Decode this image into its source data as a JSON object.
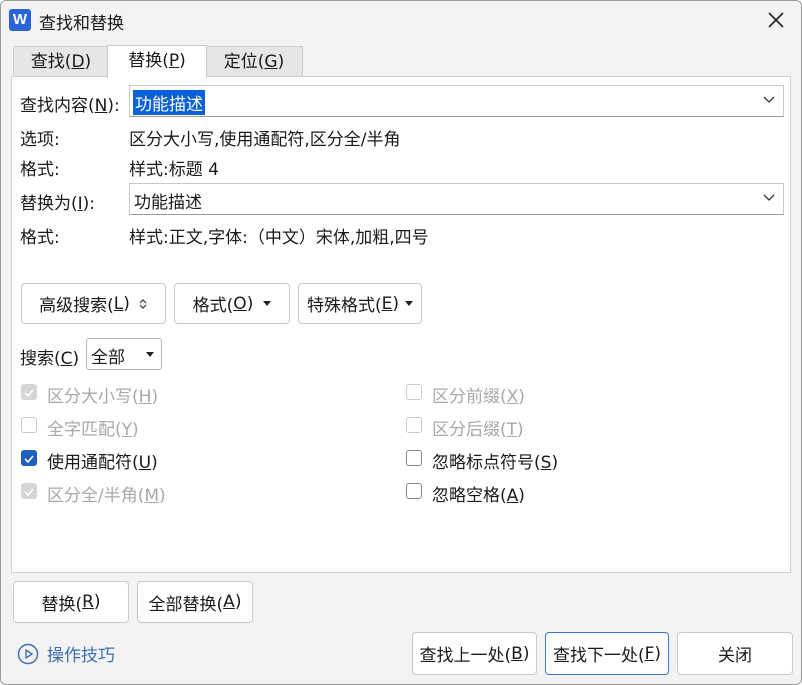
{
  "window": {
    "title": "查找和替换",
    "app_icon_letter": "W"
  },
  "tabs": [
    {
      "label": "查找(",
      "key": "D",
      "suffix": ")"
    },
    {
      "label": "替换(",
      "key": "P",
      "suffix": ")"
    },
    {
      "label": "定位(",
      "key": "G",
      "suffix": ")"
    }
  ],
  "find": {
    "label": "查找内容(",
    "key": "N",
    "suffix": "):",
    "value": "功能描述"
  },
  "options": {
    "label": "选项:",
    "value": "区分大小写,使用通配符,区分全/半角"
  },
  "find_format": {
    "label": "格式:",
    "value": "样式:标题 4"
  },
  "replace": {
    "label": "替换为(",
    "key": "I",
    "suffix": "):",
    "value": "功能描述"
  },
  "replace_format": {
    "label": "格式:",
    "value": "样式:正文,字体:（中文）宋体,加粗,四号"
  },
  "buttons": {
    "advanced": {
      "label": "高级搜索(",
      "key": "L",
      "suffix": ")"
    },
    "format": {
      "label": "格式(",
      "key": "O",
      "suffix": ")"
    },
    "special": {
      "label": "特殊格式(",
      "key": "E",
      "suffix": ")"
    },
    "replace": {
      "label": "替换(",
      "key": "R",
      "suffix": ")"
    },
    "replace_all": {
      "label": "全部替换(",
      "key": "A",
      "suffix": ")"
    },
    "find_prev": {
      "label": "查找上一处(",
      "key": "B",
      "suffix": ")"
    },
    "find_next": {
      "label": "查找下一处(",
      "key": "F",
      "suffix": ")"
    },
    "close": {
      "label": "关闭"
    }
  },
  "search": {
    "label": "搜索(",
    "key": "C",
    "suffix": ")",
    "value": "全部"
  },
  "checkboxes": {
    "match_case": {
      "label": "区分大小写(",
      "key": "H",
      "suffix": ")",
      "checked": true,
      "disabled": true
    },
    "whole_word": {
      "label": "全字匹配(",
      "key": "Y",
      "suffix": ")",
      "checked": false,
      "disabled": true
    },
    "wildcards": {
      "label": "使用通配符(",
      "key": "U",
      "suffix": ")",
      "checked": true,
      "disabled": false
    },
    "width": {
      "label": "区分全/半角(",
      "key": "M",
      "suffix": ")",
      "checked": true,
      "disabled": true
    },
    "prefix": {
      "label": "区分前缀(",
      "key": "X",
      "suffix": ")",
      "checked": false,
      "disabled": true
    },
    "suffix": {
      "label": "区分后缀(",
      "key": "T",
      "suffix": ")",
      "checked": false,
      "disabled": true
    },
    "ignore_punct": {
      "label": "忽略标点符号(",
      "key": "S",
      "suffix": ")",
      "checked": false,
      "disabled": false
    },
    "ignore_space": {
      "label": "忽略空格(",
      "key": "A",
      "suffix": ")",
      "checked": false,
      "disabled": false
    }
  },
  "tips": {
    "label": "操作技巧"
  },
  "colors": {
    "accent": "#1f5fbf",
    "selection": "#0a60d6",
    "link": "#3b6fb6"
  }
}
